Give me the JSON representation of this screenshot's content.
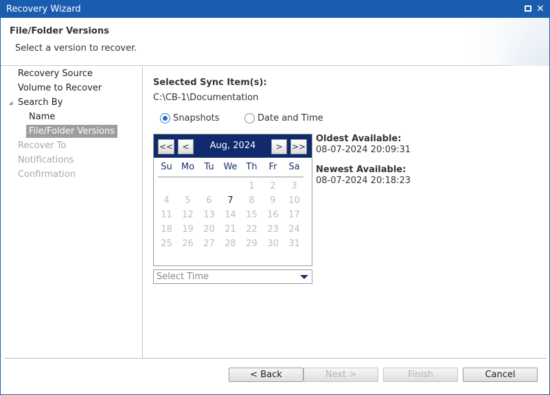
{
  "window": {
    "title": "Recovery Wizard"
  },
  "header": {
    "title": "File/Folder Versions",
    "subtitle": "Select a version to recover."
  },
  "nav": {
    "items": [
      {
        "label": "Recovery Source",
        "state": "active"
      },
      {
        "label": "Volume to Recover",
        "state": "active"
      },
      {
        "label": "Search By",
        "state": "active",
        "expanded": true
      },
      {
        "label": "Name",
        "state": "active"
      },
      {
        "label": "File/Folder Versions",
        "state": "selected"
      },
      {
        "label": "Recover To",
        "state": "disabled"
      },
      {
        "label": "Notifications",
        "state": "disabled"
      },
      {
        "label": "Confirmation",
        "state": "disabled"
      }
    ]
  },
  "content": {
    "selected_label": "Selected Sync Item(s):",
    "selected_path": "C:\\CB-1\\Documentation",
    "radios": [
      {
        "label": "Snapshots",
        "checked": true
      },
      {
        "label": "Date and Time",
        "checked": false
      }
    ]
  },
  "calendar": {
    "prev_year": "<<",
    "prev_month": "<",
    "month_label": "Aug, 2024",
    "next_month": ">",
    "next_year": ">>",
    "weekdays": [
      "Su",
      "Mo",
      "Tu",
      "We",
      "Th",
      "Fr",
      "Sa"
    ],
    "weeks": [
      [
        "",
        "",
        "",
        "",
        "1",
        "2",
        "3"
      ],
      [
        "4",
        "5",
        "6",
        "7",
        "8",
        "9",
        "10"
      ],
      [
        "11",
        "12",
        "13",
        "14",
        "15",
        "16",
        "17"
      ],
      [
        "18",
        "19",
        "20",
        "21",
        "22",
        "23",
        "24"
      ],
      [
        "25",
        "26",
        "27",
        "28",
        "29",
        "30",
        "31"
      ]
    ],
    "available_days": [
      "7"
    ]
  },
  "time_select": {
    "placeholder": "Select Time"
  },
  "availability": {
    "oldest_label": "Oldest Available:",
    "oldest_value": "08-07-2024 20:09:31",
    "newest_label": "Newest Available:",
    "newest_value": "08-07-2024 20:18:23"
  },
  "buttons": {
    "back": "< Back",
    "next": "Next >",
    "finish": "Finish",
    "cancel": "Cancel"
  },
  "colors": {
    "titlebar": "#1a5cb0",
    "calendar_header": "#102a6e",
    "nav_selected": "#9e9e9e"
  }
}
